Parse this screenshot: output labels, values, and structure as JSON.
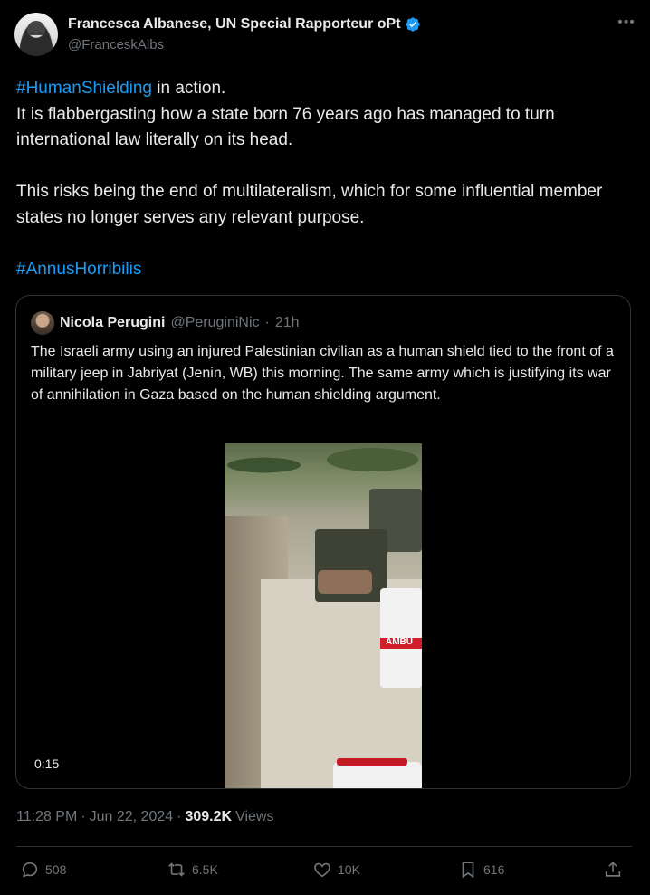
{
  "author": {
    "name": "Francesca Albanese, UN Special Rapporteur oPt",
    "handle": "@FranceskAlbs",
    "verified_color": "#1d9bf0"
  },
  "tweet": {
    "hashtag1": "#HumanShielding",
    "line1_rest": " in action.",
    "line2": "It is flabbergasting how a state born 76 years ago has managed to turn international law literally on its head.",
    "line3": "This risks being the end of multilateralism, which for some influential member states no longer serves any relevant purpose.",
    "hashtag2": "#AnnusHorribilis"
  },
  "quote": {
    "name": "Nicola Perugini",
    "handle": "@PeruginiNic",
    "time": "21h",
    "text": "The Israeli army using an injured Palestinian civilian as a human shield tied to the front of a military jeep in Jabriyat (Jenin, WB) this morning. The same army which is justifying its war of annihilation in Gaza based on the human shielding argument.",
    "video_duration": "0:15",
    "ambulance_text": "AMBU"
  },
  "meta": {
    "time": "11:28 PM",
    "date": "Jun 22, 2024",
    "views_count": "309.2K",
    "views_label": "Views"
  },
  "actions": {
    "replies": "508",
    "reposts": "6.5K",
    "likes": "10K",
    "bookmarks": "616"
  },
  "icons": {
    "more": "more-icon",
    "verified": "verified-badge-icon",
    "reply": "reply-icon",
    "repost": "repost-icon",
    "like": "like-icon",
    "bookmark": "bookmark-icon",
    "share": "share-icon"
  },
  "colors": {
    "background": "#000000",
    "text": "#e7e9ea",
    "muted": "#71767b",
    "link": "#1d9bf0",
    "border": "#2f3336"
  }
}
